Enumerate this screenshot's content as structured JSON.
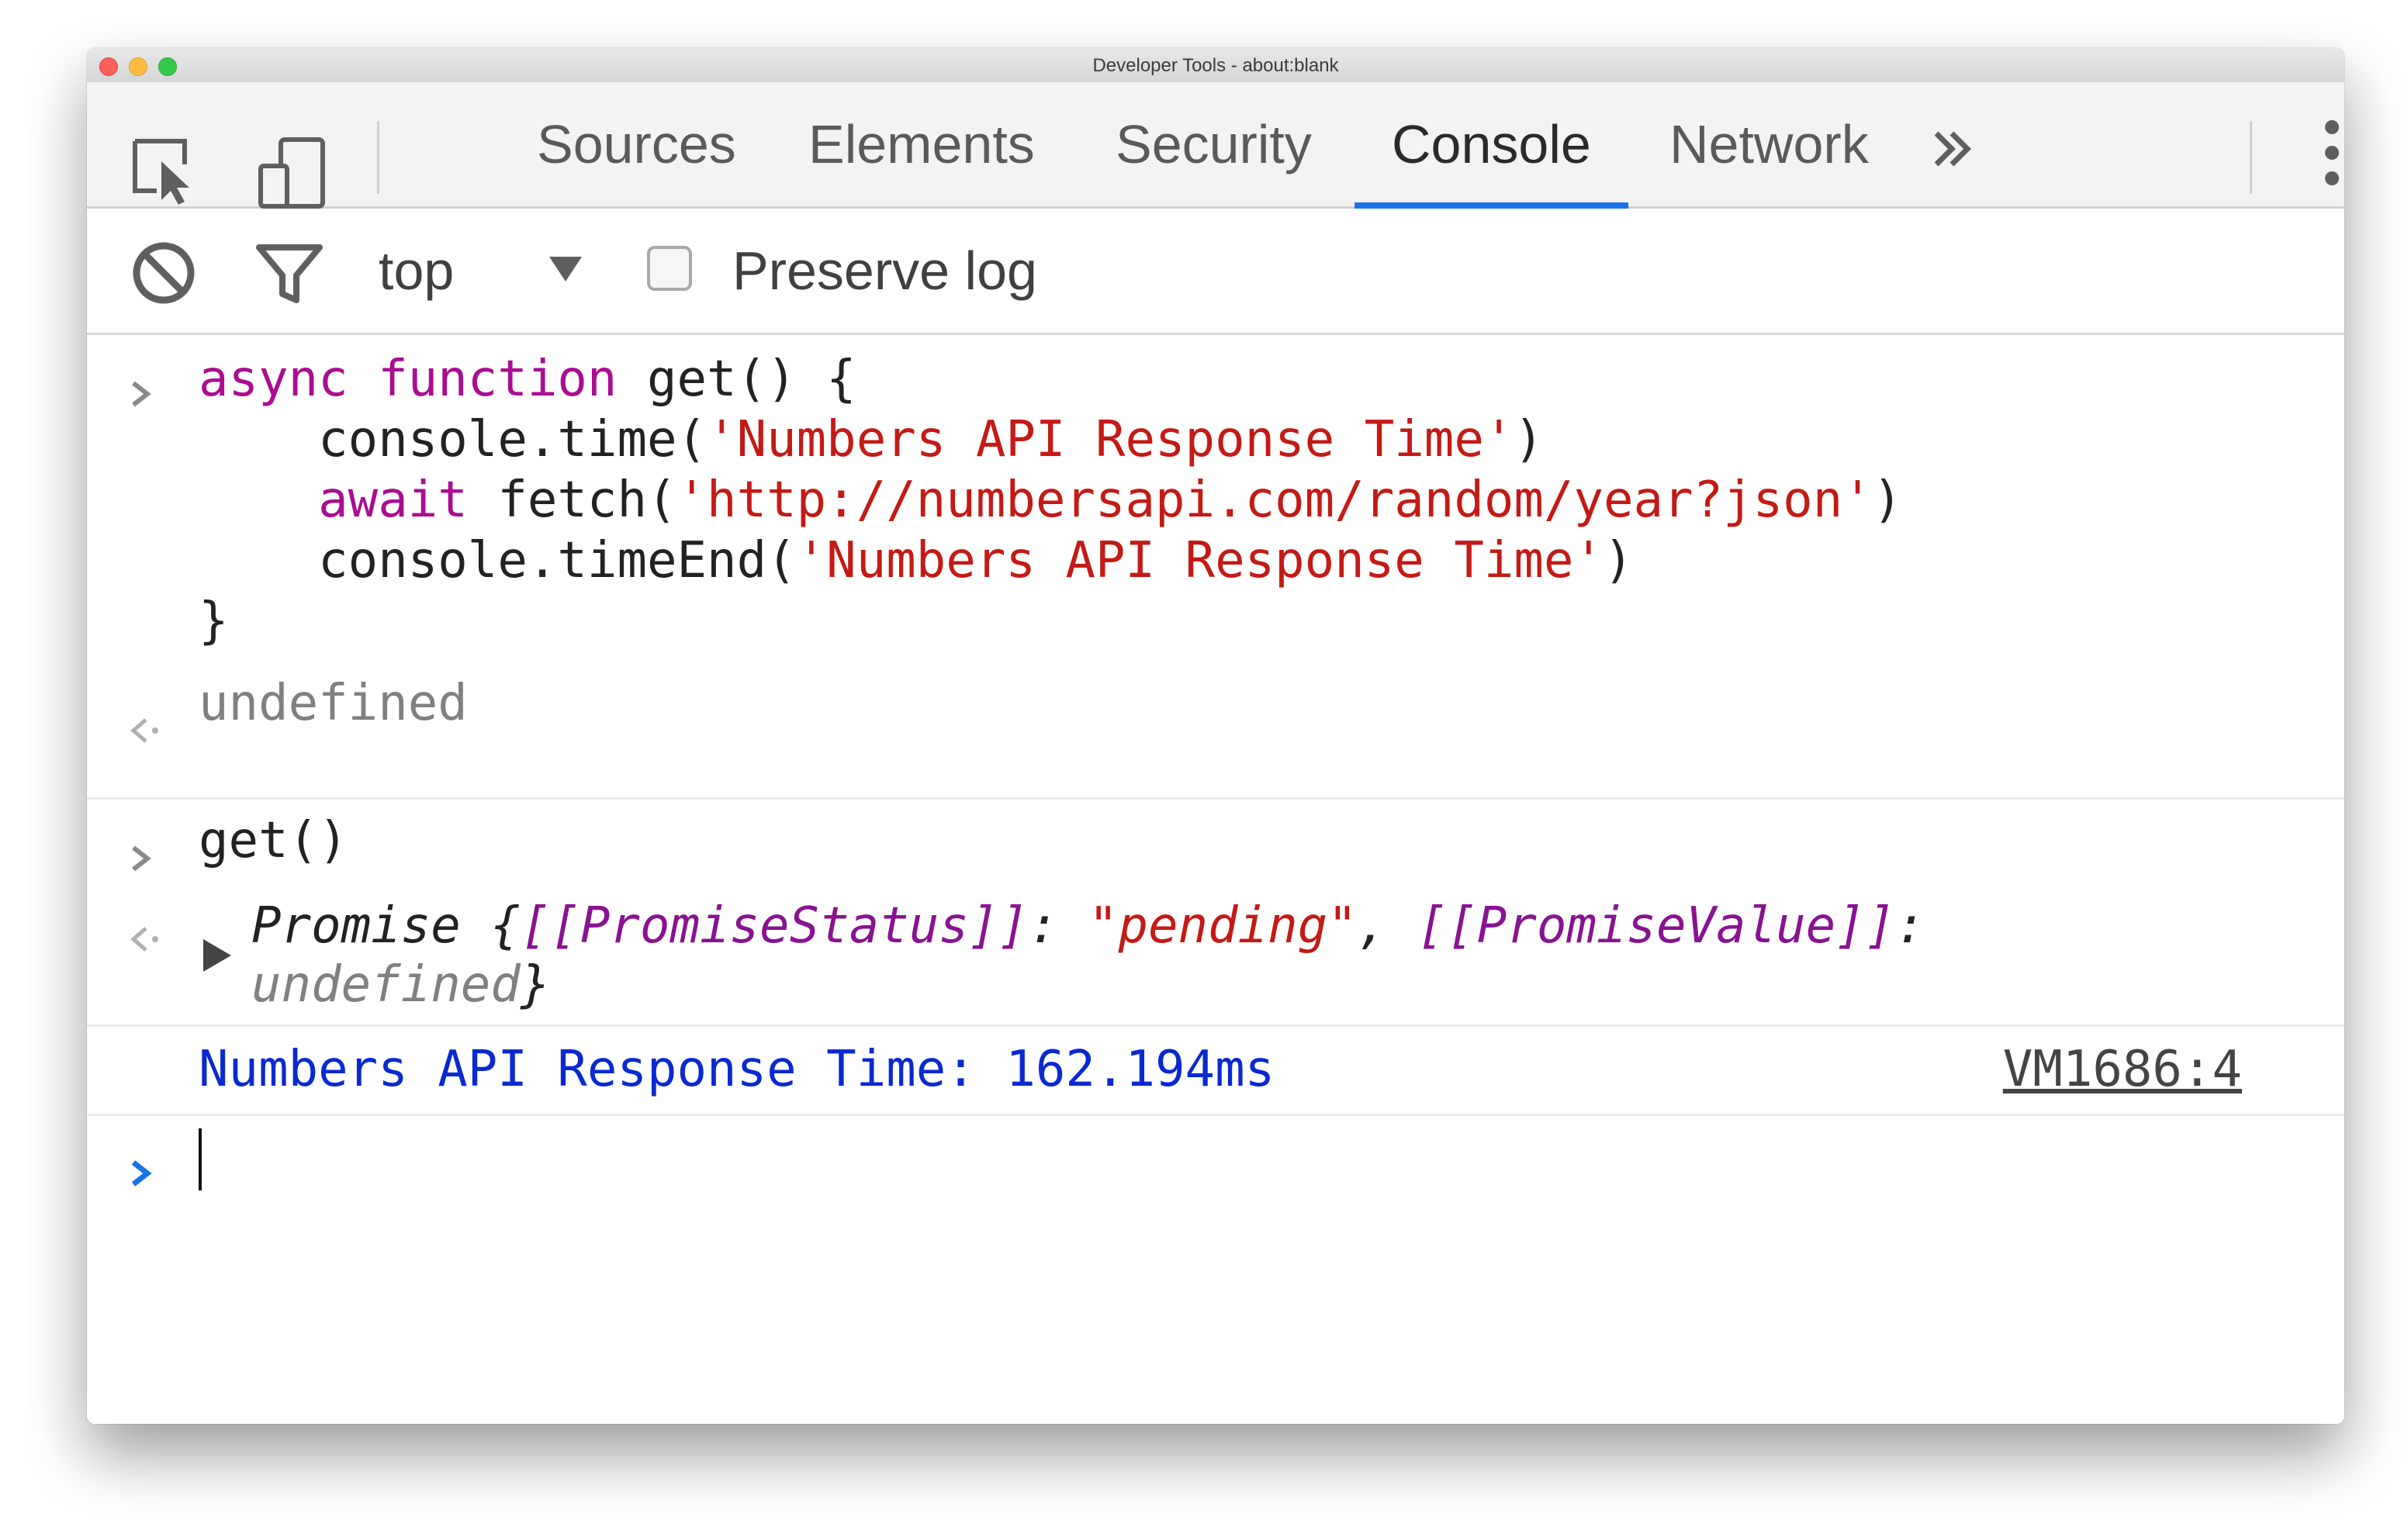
{
  "window": {
    "title": "Developer Tools - about:blank"
  },
  "tabs": [
    {
      "label": "Sources"
    },
    {
      "label": "Elements"
    },
    {
      "label": "Security"
    },
    {
      "label": "Console"
    },
    {
      "label": "Network"
    }
  ],
  "active_tab": "Console",
  "toolbar": {
    "context": "top",
    "preserve_log_label": "Preserve log",
    "preserve_log_checked": false
  },
  "console": {
    "input1": {
      "l1_kw": "async function",
      "l1_rest": " get() {",
      "l2_pre": "    console.time(",
      "l2_str": "'Numbers API Response Time'",
      "l2_post": ")",
      "l3_kw": "    await",
      "l3_mid": " fetch(",
      "l3_str": "'http://numbersapi.com/random/year?json'",
      "l3_post": ")",
      "l4_pre": "    console.timeEnd(",
      "l4_str": "'Numbers API Response Time'",
      "l4_post": ")",
      "l5": "}"
    },
    "result1": "undefined",
    "input2": "get()",
    "result2": {
      "prefix": "Promise {",
      "status_key": "[[PromiseStatus]]",
      "colon1": ": ",
      "status_val": "\"pending\"",
      "comma": ", ",
      "value_key": "[[PromiseValue]]",
      "colon2": ":",
      "value_val": "undefined",
      "suffix": "}"
    },
    "log": {
      "text": "Numbers API Response Time: 162.194ms",
      "source": "VM1686:4"
    }
  },
  "colors": {
    "accent": "#1a73e8",
    "keyword": "#aa0d91",
    "string": "#c41a16",
    "log": "#0b29d0"
  }
}
